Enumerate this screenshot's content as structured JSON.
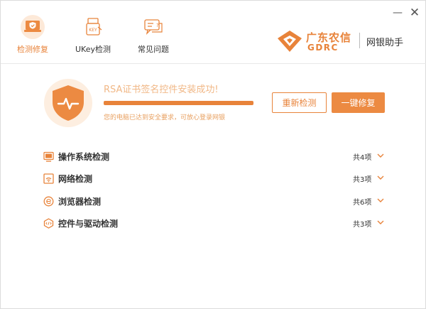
{
  "window": {
    "minimize_label": "—",
    "close_label": "✕"
  },
  "nav": {
    "tabs": [
      {
        "label": "检测修复",
        "icon": "laptop-shield-icon",
        "active": true
      },
      {
        "label": "UKey检测",
        "icon": "ukey-icon",
        "active": false
      },
      {
        "label": "常见问题",
        "icon": "faq-chat-icon",
        "active": false
      }
    ]
  },
  "brand": {
    "name_cn": "广东农信",
    "name_en": "GDRC",
    "app_name": "网银助手",
    "color": "#e8833a"
  },
  "status": {
    "title": "RSA证书签名控件安装成功!",
    "subtitle": "您的电脑已达到安全要求，可放心登录网银",
    "progress": 1.0,
    "recheck_label": "重新检测",
    "repair_label": "一键修复"
  },
  "checks": [
    {
      "label": "操作系统检测",
      "count": "共4项",
      "icon": "monitor-icon"
    },
    {
      "label": "网络检测",
      "count": "共3项",
      "icon": "network-icon"
    },
    {
      "label": "浏览器检测",
      "count": "共6项",
      "icon": "browser-icon"
    },
    {
      "label": "控件与驱动检测",
      "count": "共3项",
      "icon": "control-driver-icon"
    }
  ],
  "colors": {
    "accent": "#e8833a",
    "accent_light": "#fde9d8"
  }
}
